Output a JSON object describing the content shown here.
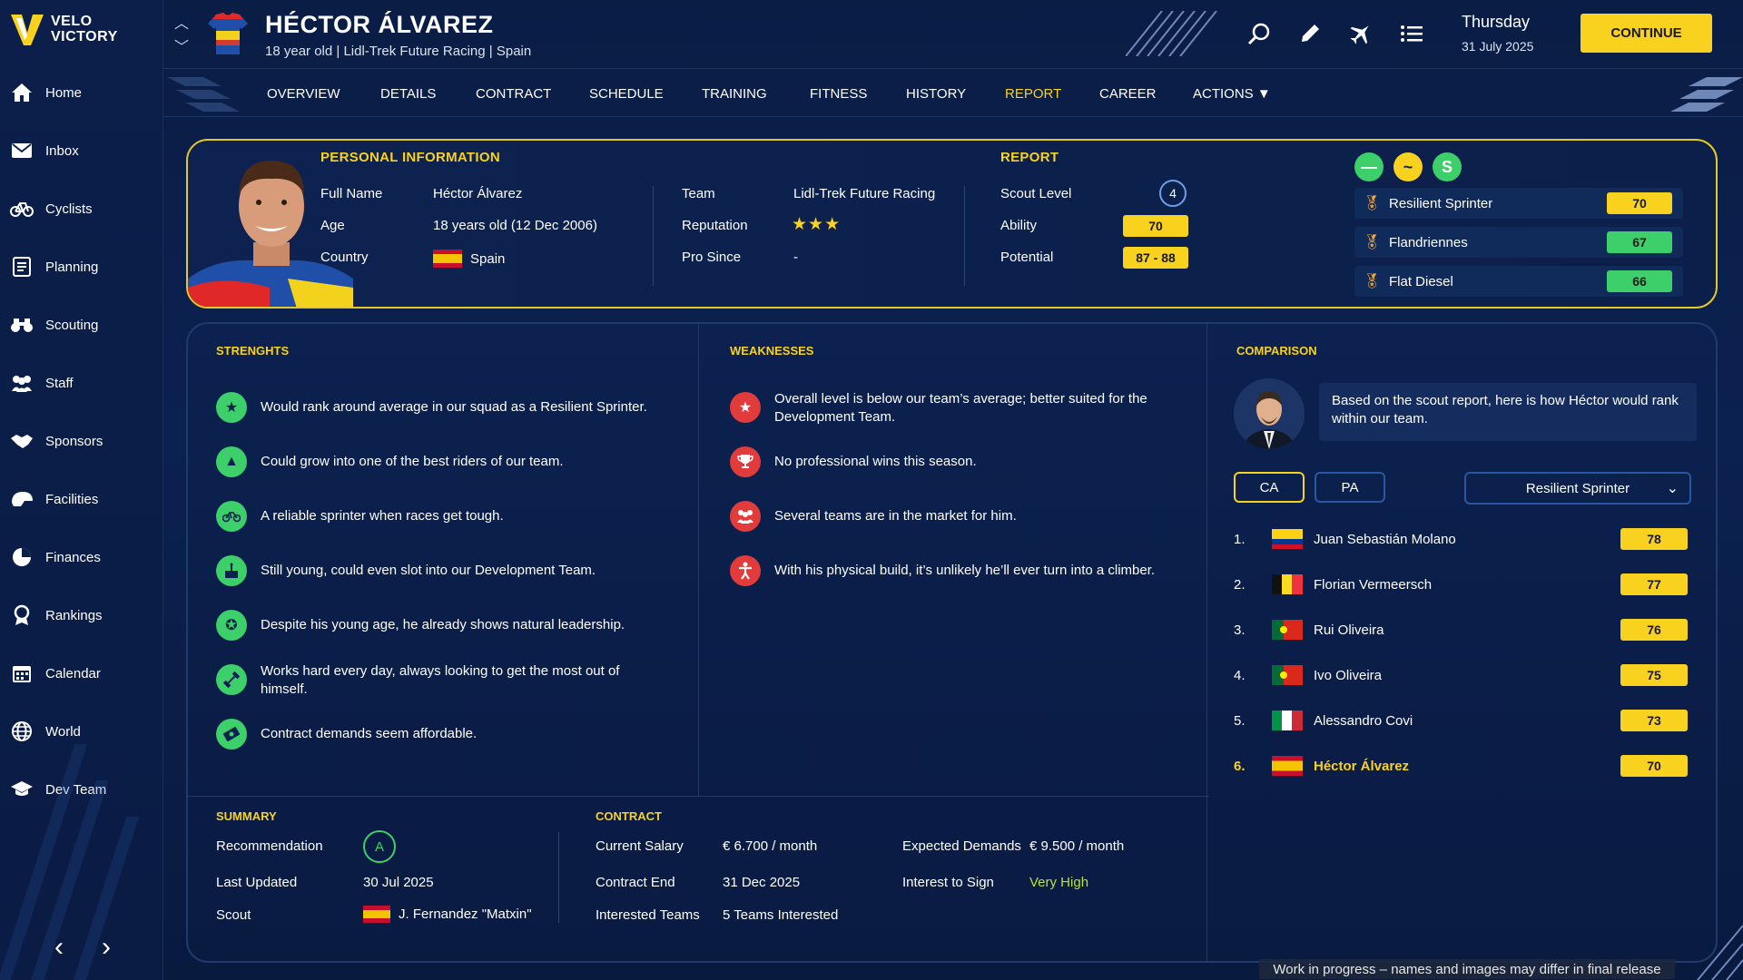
{
  "app": {
    "logo_line1": "VELO",
    "logo_line2": "VICTORY"
  },
  "sidebar": {
    "items": [
      {
        "label": "Home",
        "icon": "home-icon"
      },
      {
        "label": "Inbox",
        "icon": "inbox-icon"
      },
      {
        "label": "Cyclists",
        "icon": "bicycle-icon"
      },
      {
        "label": "Planning",
        "icon": "planning-icon"
      },
      {
        "label": "Scouting",
        "icon": "binoculars-icon"
      },
      {
        "label": "Staff",
        "icon": "staff-icon"
      },
      {
        "label": "Sponsors",
        "icon": "handshake-icon"
      },
      {
        "label": "Facilities",
        "icon": "helmet-icon"
      },
      {
        "label": "Finances",
        "icon": "pie-chart-icon"
      },
      {
        "label": "Rankings",
        "icon": "medal-icon"
      },
      {
        "label": "Calendar",
        "icon": "calendar-icon"
      },
      {
        "label": "World",
        "icon": "globe-icon"
      },
      {
        "label": "Dev Team",
        "icon": "graduation-cap-icon"
      }
    ]
  },
  "header": {
    "name": "HÉCTOR ÁLVAREZ",
    "subtitle": "18 year old  | Lidl-Trek Future Racing | Spain",
    "day": "Thursday",
    "date": "31 July 2025",
    "continue_label": "CONTINUE"
  },
  "tabs": [
    "OVERVIEW",
    "DETAILS",
    "CONTRACT",
    "SCHEDULE",
    "TRAINING",
    "FITNESS",
    "HISTORY",
    "REPORT",
    "CAREER",
    "ACTIONS ▼"
  ],
  "active_tab": "REPORT",
  "personal": {
    "title": "PERSONAL INFORMATION",
    "full_name_label": "Full Name",
    "full_name": "Héctor Álvarez",
    "age_label": "Age",
    "age": "18 years old (12 Dec 2006)",
    "country_label": "Country",
    "country": "Spain",
    "team_label": "Team",
    "team": "Lidl-Trek Future Racing",
    "reputation_label": "Reputation",
    "reputation_stars": "★★★",
    "pro_since_label": "Pro Since",
    "pro_since": "-"
  },
  "report": {
    "title": "REPORT",
    "scout_level_label": "Scout Level",
    "scout_level": "4",
    "ability_label": "Ability",
    "ability": "70",
    "potential_label": "Potential",
    "potential": "87 - 88"
  },
  "roles": [
    {
      "name": "Resilient Sprinter",
      "score": "70",
      "color": "#f8d21f"
    },
    {
      "name": "Flandriennes",
      "score": "67",
      "color": "#3ccf6a"
    },
    {
      "name": "Flat Diesel",
      "score": "66",
      "color": "#3ccf6a"
    }
  ],
  "role_circles": [
    {
      "symbol": "—",
      "color": "#3ccf6a"
    },
    {
      "symbol": "~",
      "color": "#f8d21f"
    },
    {
      "symbol": "S",
      "color": "#3ccf6a"
    }
  ],
  "strengths": {
    "title": "STRENGHTS",
    "items": [
      {
        "text": "Would rank around average in our squad as a Resilient Sprinter.",
        "icon": "star-icon"
      },
      {
        "text": "Could grow into one of the best riders of our team.",
        "icon": "growth-icon"
      },
      {
        "text": "A reliable sprinter when races get tough.",
        "icon": "bicycle-icon"
      },
      {
        "text": "Still young, could even slot into our Development Team.",
        "icon": "cake-icon"
      },
      {
        "text": "Despite his young age, he already shows natural leadership.",
        "icon": "leadership-icon"
      },
      {
        "text": "Works hard every day, always looking to get the most out of himself.",
        "icon": "dumbbell-icon"
      },
      {
        "text": "Contract demands seem affordable.",
        "icon": "money-icon"
      }
    ]
  },
  "weaknesses": {
    "title": "WEAKNESSES",
    "items": [
      {
        "text": "Overall level is below our team’s average; better suited for the Development Team.",
        "icon": "star-icon"
      },
      {
        "text": "No professional wins this season.",
        "icon": "trophy-icon"
      },
      {
        "text": "Several teams are in the market for him.",
        "icon": "group-icon"
      },
      {
        "text": "With his physical build, it’s unlikely he’ll ever turn into a climber.",
        "icon": "person-icon"
      }
    ]
  },
  "comparison": {
    "title": "COMPARISON",
    "speech": "Based on the scout report, here is how Héctor would rank within our team.",
    "toggle_ca": "CA",
    "toggle_pa": "PA",
    "dropdown": "Resilient Sprinter",
    "ranking": [
      {
        "rank": "1.",
        "name": "Juan Sebastián Molano",
        "score": "78",
        "flag": "colombia"
      },
      {
        "rank": "2.",
        "name": "Florian Vermeersch",
        "score": "77",
        "flag": "belgium"
      },
      {
        "rank": "3.",
        "name": "Rui Oliveira",
        "score": "76",
        "flag": "portugal"
      },
      {
        "rank": "4.",
        "name": "Ivo Oliveira",
        "score": "75",
        "flag": "portugal"
      },
      {
        "rank": "5.",
        "name": "Alessandro Covi",
        "score": "73",
        "flag": "italy"
      },
      {
        "rank": "6.",
        "name": "Héctor Álvarez",
        "score": "70",
        "flag": "spain"
      }
    ]
  },
  "summary": {
    "title": "SUMMARY",
    "recommendation_label": "Recommendation",
    "recommendation": "A",
    "last_updated_label": "Last Updated",
    "last_updated": "30 Jul 2025",
    "scout_label": "Scout",
    "scout": "J. Fernandez \"Matxin\""
  },
  "contract": {
    "title": "CONTRACT",
    "salary_label": "Current Salary",
    "salary": "€ 6.700 / month",
    "end_label": "Contract End",
    "end": "31 Dec 2025",
    "teams_label": "Interested Teams",
    "teams": "5 Teams Interested",
    "demands_label": "Expected Demands",
    "demands": "€ 9.500 / month",
    "interest_label": "Interest to Sign",
    "interest": "Very High"
  },
  "footer_note": "Work in progress – names and images may differ in final release"
}
